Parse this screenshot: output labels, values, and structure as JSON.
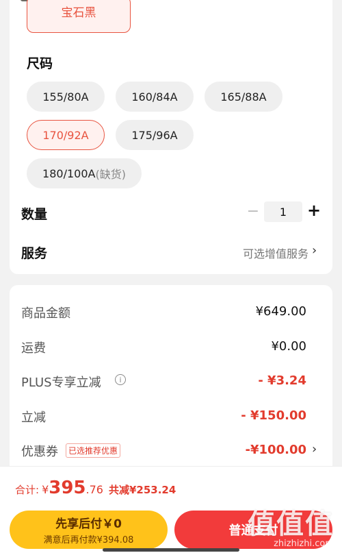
{
  "color_option": {
    "label": "宝石黑"
  },
  "size_section": {
    "title": "尺码",
    "options": [
      {
        "label": "155/80A",
        "note": ""
      },
      {
        "label": "160/84A",
        "note": ""
      },
      {
        "label": "165/88A",
        "note": ""
      },
      {
        "label": "170/92A",
        "note": ""
      },
      {
        "label": "175/96A",
        "note": ""
      },
      {
        "label": "180/100A",
        "note": "(缺货)"
      }
    ],
    "selected": "170/92A"
  },
  "quantity": {
    "label": "数量",
    "minus": "−",
    "value": "1",
    "plus": "+"
  },
  "service": {
    "label": "服务",
    "value": "可选增值服务"
  },
  "fees": {
    "goods": {
      "label": "商品金额",
      "value": "¥649.00"
    },
    "shipping": {
      "label": "运费",
      "value": "¥0.00"
    },
    "plus": {
      "label": "PLUS专享立减",
      "value": "- ¥3.24",
      "info_icon": "i"
    },
    "discount": {
      "label": "立减",
      "value": "- ¥150.00"
    },
    "coupon": {
      "label": "优惠券",
      "tag": "已选推荐优惠",
      "value": "-¥100.00"
    }
  },
  "total": {
    "label": "合计:",
    "currency": "¥",
    "integer": "395",
    "decimal": ".76",
    "saved": "共减¥253.24"
  },
  "buttons": {
    "pay_later_main": "先享后付￥0",
    "pay_later_sub": "满意后再付款¥394.08",
    "pay_normal": "普通支付"
  },
  "watermark": {
    "big": "值值值",
    "small": "zhizhizhi.com"
  },
  "colors": {
    "accent": "#e23b2d",
    "pay_later": "#ffc21a",
    "pay_button": "#f23b3b"
  },
  "icons": {
    "chevron": "chevron-right-icon",
    "info": "info-icon"
  }
}
